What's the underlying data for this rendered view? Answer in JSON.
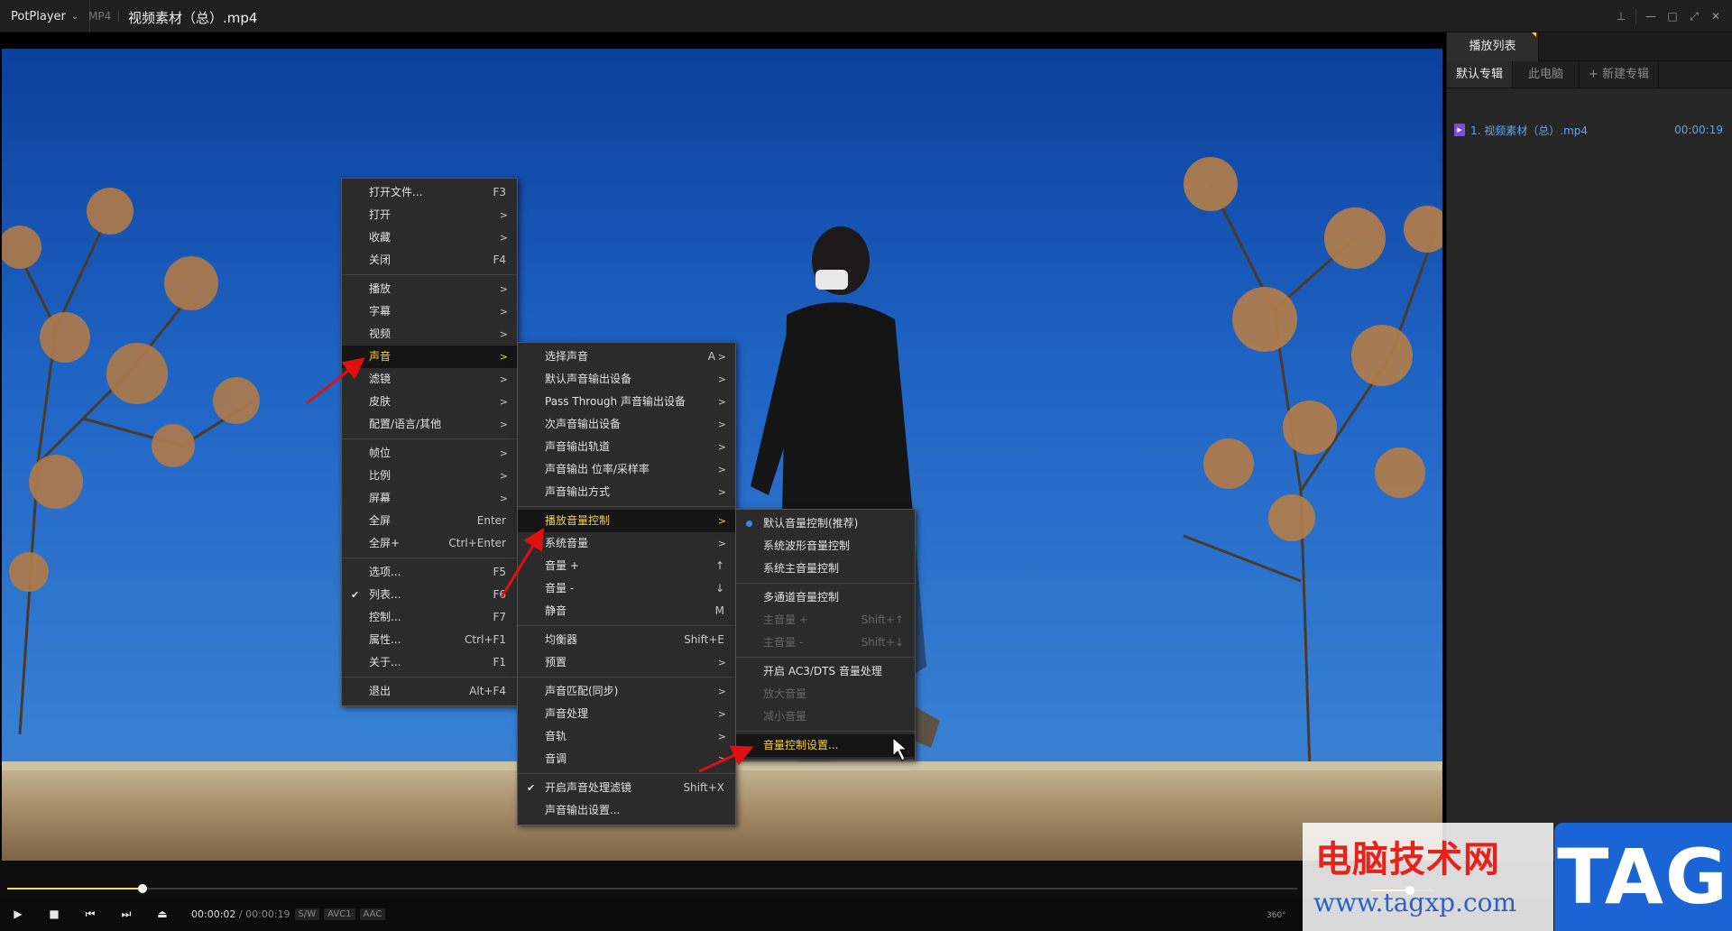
{
  "titlebar": {
    "app_name": "PotPlayer",
    "format": "MP4",
    "file_title": "视频素材（总）.mp4"
  },
  "sidebar": {
    "tab": "播放列表",
    "subtabs": [
      "默认专辑",
      "此电脑",
      "+ 新建专辑"
    ],
    "items": [
      {
        "name": "1. 视频素材（总）.mp4",
        "duration": "00:00:19"
      }
    ]
  },
  "player": {
    "current_time": "00:00:02",
    "separator": "/",
    "duration": "00:00:19",
    "tags": [
      "S/W",
      "AVC1",
      "AAC"
    ],
    "progress": 0.105,
    "volume": 0.62,
    "degree_label": "360°"
  },
  "main_menu": [
    {
      "label": "打开文件...",
      "shortcut": "F3"
    },
    {
      "label": "打开",
      "arrow": ">"
    },
    {
      "label": "收藏",
      "arrow": ">"
    },
    {
      "label": "关闭",
      "shortcut": "F4"
    },
    {
      "sep": true
    },
    {
      "label": "播放",
      "arrow": ">"
    },
    {
      "label": "字幕",
      "arrow": ">"
    },
    {
      "label": "视频",
      "arrow": ">"
    },
    {
      "label": "声音",
      "arrow": ">",
      "highlight": true
    },
    {
      "label": "滤镜",
      "arrow": ">"
    },
    {
      "label": "皮肤",
      "arrow": ">"
    },
    {
      "label": "配置/语言/其他",
      "arrow": ">"
    },
    {
      "sep": true
    },
    {
      "label": "帧位",
      "arrow": ">"
    },
    {
      "label": "比例",
      "arrow": ">"
    },
    {
      "label": "屏幕",
      "arrow": ">"
    },
    {
      "label": "全屏",
      "shortcut": "Enter"
    },
    {
      "label": "全屏+",
      "shortcut": "Ctrl+Enter"
    },
    {
      "sep": true
    },
    {
      "label": "选项...",
      "shortcut": "F5"
    },
    {
      "label": "列表...",
      "shortcut": "F6",
      "checked": true
    },
    {
      "label": "控制...",
      "shortcut": "F7"
    },
    {
      "label": "属性...",
      "shortcut": "Ctrl+F1"
    },
    {
      "label": "关于...",
      "shortcut": "F1"
    },
    {
      "sep": true
    },
    {
      "label": "退出",
      "shortcut": "Alt+F4"
    }
  ],
  "sound_menu": [
    {
      "label": "选择声音",
      "shortcut": "A",
      "arrow": ">"
    },
    {
      "label": "默认声音输出设备",
      "arrow": ">"
    },
    {
      "label": "Pass Through 声音输出设备",
      "arrow": ">"
    },
    {
      "label": "次声音输出设备",
      "arrow": ">"
    },
    {
      "label": "声音输出轨道",
      "arrow": ">"
    },
    {
      "label": "声音输出 位率/采样率",
      "arrow": ">"
    },
    {
      "label": "声音输出方式",
      "arrow": ">"
    },
    {
      "sep": true
    },
    {
      "label": "播放音量控制",
      "arrow": ">",
      "highlight": true
    },
    {
      "label": "系统音量",
      "arrow": ">"
    },
    {
      "label": "音量 +",
      "shortcut": "↑"
    },
    {
      "label": "音量 -",
      "shortcut": "↓"
    },
    {
      "label": "静音",
      "shortcut": "M"
    },
    {
      "sep": true
    },
    {
      "label": "均衡器",
      "shortcut": "Shift+E"
    },
    {
      "label": "预置",
      "arrow": ">"
    },
    {
      "sep": true
    },
    {
      "label": "声音匹配(同步)",
      "arrow": ">"
    },
    {
      "label": "声音处理",
      "arrow": ">"
    },
    {
      "label": "音轨",
      "arrow": ">"
    },
    {
      "label": "音调",
      "arrow": ">"
    },
    {
      "sep": true
    },
    {
      "label": "开启声音处理滤镜",
      "shortcut": "Shift+X",
      "checked": true
    },
    {
      "label": "声音输出设置..."
    }
  ],
  "volume_menu": [
    {
      "label": "默认音量控制(推荐)",
      "radio": true
    },
    {
      "label": "系统波形音量控制"
    },
    {
      "label": "系统主音量控制"
    },
    {
      "sep": true
    },
    {
      "label": "多通道音量控制"
    },
    {
      "label": "主音量 +",
      "shortcut": "Shift+↑",
      "disabled": true
    },
    {
      "label": "主音量 -",
      "shortcut": "Shift+↓",
      "disabled": true
    },
    {
      "sep": true
    },
    {
      "label": "开启 AC3/DTS 音量处理"
    },
    {
      "label": "放大音量",
      "disabled": true
    },
    {
      "label": "减小音量",
      "disabled": true
    },
    {
      "sep": true
    },
    {
      "label": "音量控制设置...",
      "highlight": true
    }
  ],
  "watermark": {
    "text_cn": "电脑技术网",
    "url": "www.tagxp.com",
    "tag": "TAG"
  },
  "colors": {
    "accent_yellow": "#f5d142",
    "arrow_red": "#e01010",
    "playlist_blue": "#5fa4f2"
  }
}
